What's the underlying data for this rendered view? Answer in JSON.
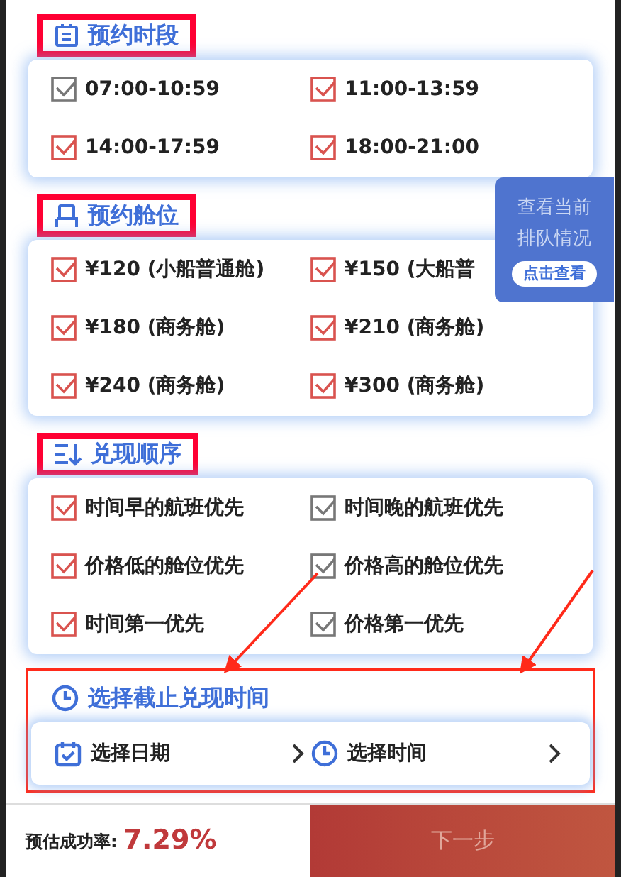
{
  "sections": [
    {
      "title": "预约时段",
      "kind": "list",
      "options": [
        {
          "label": "07:00-10:59",
          "selected": false
        },
        {
          "label": "11:00-13:59",
          "selected": true
        },
        {
          "label": "14:00-17:59",
          "selected": true
        },
        {
          "label": "18:00-21:00",
          "selected": true
        }
      ]
    },
    {
      "title": "预约舱位",
      "kind": "seat",
      "options": [
        {
          "label": "¥120 (小船普通舱)",
          "selected": true
        },
        {
          "label": "¥150 (大船普",
          "selected": true
        },
        {
          "label": "¥180 (商务舱)",
          "selected": true
        },
        {
          "label": "¥210 (商务舱)",
          "selected": true
        },
        {
          "label": "¥240 (商务舱)",
          "selected": true
        },
        {
          "label": "¥300 (商务舱)",
          "selected": true
        }
      ]
    },
    {
      "title": "兑现顺序",
      "kind": "sort",
      "options": [
        {
          "label": "时间早的航班优先",
          "selected": true
        },
        {
          "label": "时间晚的航班优先",
          "selected": false
        },
        {
          "label": "价格低的舱位优先",
          "selected": true
        },
        {
          "label": "价格高的舱位优先",
          "selected": false
        },
        {
          "label": "时间第一优先",
          "selected": true
        },
        {
          "label": "价格第一优先",
          "selected": false
        }
      ]
    }
  ],
  "deadline": {
    "title": "选择截止兑现时间",
    "pickers": [
      {
        "kind": "date",
        "label": "选择日期"
      },
      {
        "kind": "time",
        "label": "选择时间"
      }
    ]
  },
  "queue_popup": {
    "text": "查看当前排队情况",
    "button": "点击查看"
  },
  "footer": {
    "label": "预估成功率:",
    "rate": "7.29%",
    "button": "下一步"
  }
}
